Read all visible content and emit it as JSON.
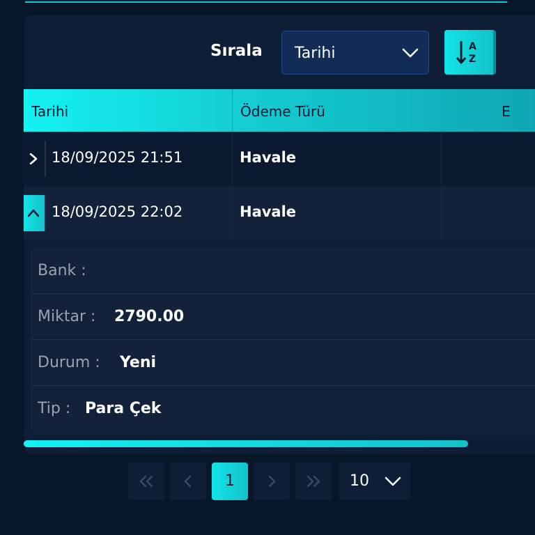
{
  "sort": {
    "label": "Sırala",
    "selected": "Tarihi",
    "direction_icon": "sort-alpha-down-icon"
  },
  "table": {
    "columns": [
      "Tarihi",
      "Ödeme Türü",
      "E"
    ],
    "rows": [
      {
        "date": "18/09/2025 21:51",
        "type": "Havale",
        "expanded": false
      },
      {
        "date": "18/09/2025 22:02",
        "type": "Havale",
        "expanded": true
      }
    ]
  },
  "detail": {
    "fields": [
      {
        "label": "Bank :",
        "value": ""
      },
      {
        "label": "Miktar :",
        "value": "2790.00"
      },
      {
        "label": "Durum :",
        "value": "Yeni"
      },
      {
        "label": "Tip :",
        "value": "Para Çek"
      }
    ]
  },
  "scroll": {
    "position_fraction": 0.87
  },
  "pagination": {
    "current_page": "1",
    "page_size": "10"
  },
  "colors": {
    "accent": "#14f2f2",
    "background": "#081629",
    "panel": "#0d1e36",
    "select": "#102c57"
  }
}
